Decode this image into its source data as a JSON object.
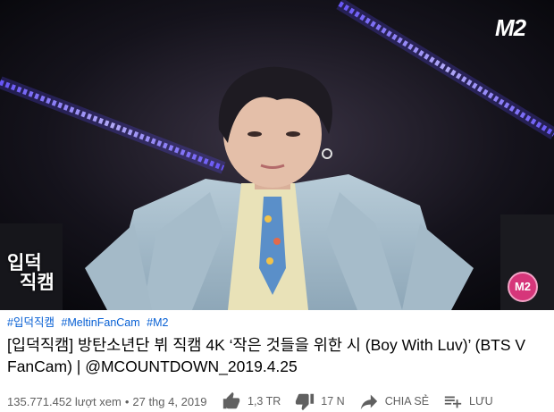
{
  "video": {
    "corner_logo": "M2",
    "overlay_label_line1": "입덕",
    "overlay_label_line2": "직캠",
    "badge": "M2"
  },
  "hashtags": [
    "#입덕직캠",
    "#MeltinFanCam",
    "#M2"
  ],
  "title": "[입덕직캠] 방탄소년단 뷔 직캠 4K ‘작은 것들을 위한 시 (Boy With Luv)’ (BTS V FanCam) | @MCOUNTDOWN_2019.4.25",
  "meta": {
    "views": "135.771.452 lượt xem",
    "separator": "•",
    "date": "27 thg 4, 2019"
  },
  "actions": {
    "like": {
      "label": "1,3 TR",
      "icon": "thumbs-up-icon"
    },
    "dislike": {
      "label": "17 N",
      "icon": "thumbs-down-icon"
    },
    "share": {
      "label": "CHIA SẺ",
      "icon": "share-icon"
    },
    "save": {
      "label": "LƯU",
      "icon": "playlist-add-icon"
    }
  },
  "colors": {
    "link": "#065fd4",
    "text": "#030303",
    "muted": "#606060",
    "stage_light": "#8a7cff",
    "badge": "#d6367a"
  }
}
